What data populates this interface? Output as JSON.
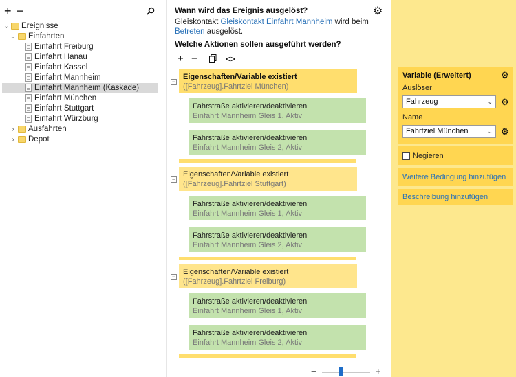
{
  "tree_toolbar": {
    "add_glyph": "+",
    "remove_glyph": "−",
    "search_icon": "search-icon"
  },
  "tree": {
    "root": "Ereignisse",
    "folder1": "Einfahrten",
    "items": [
      "Einfahrt Freiburg",
      "Einfahrt Hanau",
      "Einfahrt Kassel",
      "Einfahrt Mannheim",
      "Einfahrt Mannheim (Kaskade)",
      "Einfahrt München",
      "Einfahrt Stuttgart",
      "Einfahrt Würzburg"
    ],
    "folder2": "Ausfahrten",
    "folder3": "Depot"
  },
  "trigger": {
    "question": "Wann wird das Ereignis ausgelöst?",
    "text_before": "Gleiskontakt ",
    "link1": "Gleiskontakt Einfahrt Mannheim",
    "text_middle": " wird beim",
    "link2": "Betreten",
    "text_after": " ausgelöst."
  },
  "actions": {
    "question": "Welche Aktionen sollen ausgeführt werden?",
    "toolbar": {
      "add_glyph": "+",
      "remove_glyph": "−",
      "code_glyph": "<>"
    }
  },
  "conditions": [
    {
      "title": "Eigenschaften/Variable existiert",
      "subtitle": "([Fahrzeug].Fahrtziel München)",
      "actions": [
        {
          "title": "Fahrstraße aktivieren/deaktivieren",
          "subtitle": "Einfahrt Mannheim Gleis 1, Aktiv"
        },
        {
          "title": "Fahrstraße aktivieren/deaktivieren",
          "subtitle": "Einfahrt Mannheim Gleis 2, Aktiv"
        }
      ]
    },
    {
      "title": "Eigenschaften/Variable existiert",
      "subtitle": "([Fahrzeug].Fahrtziel Stuttgart)",
      "actions": [
        {
          "title": "Fahrstraße aktivieren/deaktivieren",
          "subtitle": "Einfahrt Mannheim Gleis 1, Aktiv"
        },
        {
          "title": "Fahrstraße aktivieren/deaktivieren",
          "subtitle": "Einfahrt Mannheim Gleis 2, Aktiv"
        }
      ]
    },
    {
      "title": "Eigenschaften/Variable existiert",
      "subtitle": "([Fahrzeug].Fahrtziel Freiburg)",
      "actions": [
        {
          "title": "Fahrstraße aktivieren/deaktivieren",
          "subtitle": "Einfahrt Mannheim Gleis 1, Aktiv"
        },
        {
          "title": "Fahrstraße aktivieren/deaktivieren",
          "subtitle": "Einfahrt Mannheim Gleis 2, Aktiv"
        }
      ]
    }
  ],
  "zoom": {
    "minus": "−",
    "plus": "+",
    "level": 0.4
  },
  "properties": {
    "title": "Variable (Erweitert)",
    "trigger_label": "Auslöser",
    "trigger_value": "Fahrzeug",
    "name_label": "Name",
    "name_value": "Fahrtziel München",
    "negate_label": "Negieren",
    "negate_checked": false,
    "add_condition": "Weitere Bedingung hinzufügen",
    "add_description": "Beschreibung hinzufügen"
  },
  "colors": {
    "condition": "#ffde6e",
    "action": "#c3e2ad",
    "side_panel": "#fde88e",
    "prop_card": "#ffd651",
    "link": "#2a72b8",
    "selection": "#d9d9d9"
  }
}
